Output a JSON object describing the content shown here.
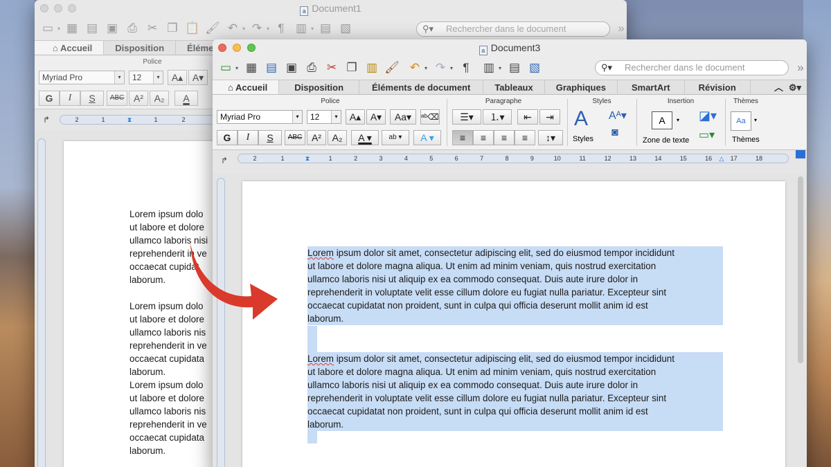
{
  "back_window": {
    "title": "Document1",
    "search_placeholder": "Rechercher dans le document",
    "tabs": [
      "Accueil",
      "Disposition",
      "Élémen"
    ],
    "ribbon_group": "Police",
    "font_name": "Myriad Pro",
    "font_size": "12",
    "format_labels": {
      "bold": "G",
      "italic": "I",
      "underline": "S",
      "strike": "ABC"
    },
    "ruler_numbers": [
      "2",
      "1",
      "1",
      "2"
    ],
    "paragraphs": [
      "Lorem ipsum dolo\nut labore et dolore\nullamco laboris nisi\nreprehenderit in ve\noccaecat cupidat\nlaborum.",
      "Lorem ipsum dolo\nut labore et dolore\nullamco laboris nis\nreprehenderit in ve\noccaecat cupidata\nlaborum.",
      "Lorem ipsum dolo\nut labore et dolore\nullamco laboris nis\nreprehenderit in ve\noccaecat cupidata\nlaborum."
    ]
  },
  "front_window": {
    "title": "Document3",
    "search_placeholder": "Rechercher dans le document",
    "tabs": [
      "Accueil",
      "Disposition",
      "Éléments de document",
      "Tableaux",
      "Graphiques",
      "SmartArt",
      "Révision"
    ],
    "groups": {
      "police": "Police",
      "paragraphe": "Paragraphe",
      "styles": "Styles",
      "insertion": "Insertion",
      "themes": "Thèmes"
    },
    "font_name": "Myriad Pro",
    "font_size": "12",
    "format_labels": {
      "bold": "G",
      "italic": "I",
      "underline": "S",
      "strike": "ABC"
    },
    "buttons": {
      "styles": "Styles",
      "text_box": "Zone de texte",
      "themes": "Thèmes"
    },
    "ruler_numbers": [
      "2",
      "1",
      "1",
      "2",
      "3",
      "4",
      "5",
      "6",
      "7",
      "8",
      "9",
      "10",
      "11",
      "12",
      "13",
      "14",
      "15",
      "16",
      "17",
      "18"
    ],
    "paragraph_1": "ipsum dolor sit amet, consectetur adipiscing elit, sed do eiusmod tempor incididunt\nut labore et dolore magna aliqua. Ut enim ad minim veniam, quis nostrud exercitation\nullamco laboris nisi ut aliquip ex ea commodo consequat. Duis aute irure dolor in\nreprehenderit in voluptate velit esse cillum dolore eu fugiat nulla pariatur. Excepteur sint\noccaecat cupidatat non proident, sunt in culpa qui officia deserunt mollit anim id est\nlaborum.",
    "paragraph_2": "ipsum dolor sit amet, consectetur adipiscing elit, sed do eiusmod tempor incididunt\nut labore et dolore magna aliqua. Ut enim ad minim veniam, quis nostrud exercitation\nullamco laboris nisi ut aliquip ex ea commodo consequat. Duis aute irure dolor in\nreprehenderit in voluptate velit esse cillum dolore eu fugiat nulla pariatur. Excepteur sint\noccaecat cupidatat non proident, sunt in culpa qui officia deserunt mollit anim id est\nlaborum.",
    "first_word": "Lorem",
    "selection_color": "#c7dcf5"
  },
  "arrow_color": "#d93a2b"
}
